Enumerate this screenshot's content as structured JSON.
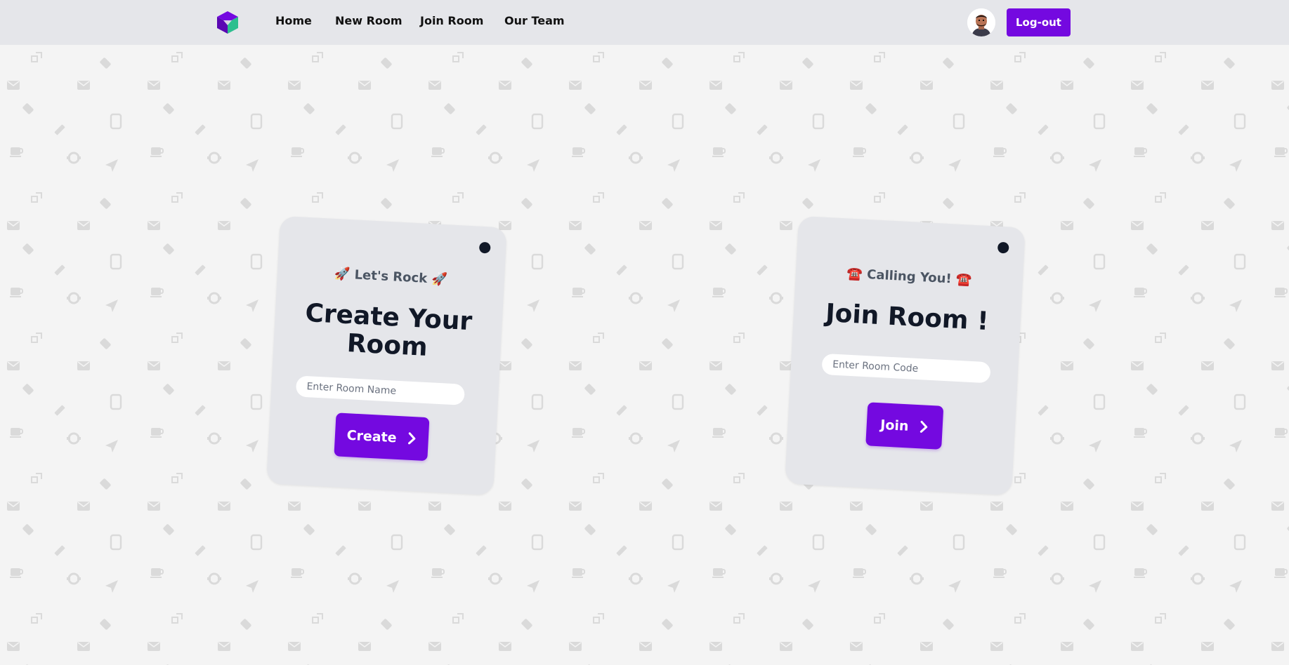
{
  "navbar": {
    "links": {
      "home": "Home",
      "new_room": "New Room",
      "join_room": "Join Room",
      "our_team": "Our Team"
    },
    "logout_label": "Log-out",
    "logo_icon": "cube-logo-icon",
    "avatar_icon": "user-avatar-icon"
  },
  "create_card": {
    "eyebrow": "🚀 Let's Rock 🚀",
    "title": "Create Your Room",
    "input_placeholder": "Enter Room Name",
    "input_value": "",
    "button_label": "Create",
    "button_icon": "chevron-right-icon"
  },
  "join_card": {
    "eyebrow": "☎️ Calling You! ☎️",
    "title": "Join Room !",
    "input_placeholder": "Enter Room Code",
    "input_value": "",
    "button_label": "Join",
    "button_icon": "chevron-right-icon"
  },
  "colors": {
    "accent": "#7409e0",
    "navbar_bg": "#e5e6ea",
    "page_bg": "#f4f4f4",
    "card_bg": "#e5e6ea",
    "pattern_icon": "#d9d9d9",
    "logo_purple": "#7409e0",
    "logo_teal": "#2dbf8f"
  },
  "background_pattern_icons": [
    "expand-icon",
    "tag-icon",
    "mail-icon",
    "phone-icon",
    "pencil-icon",
    "coffee-icon",
    "link-icon",
    "send-icon"
  ]
}
